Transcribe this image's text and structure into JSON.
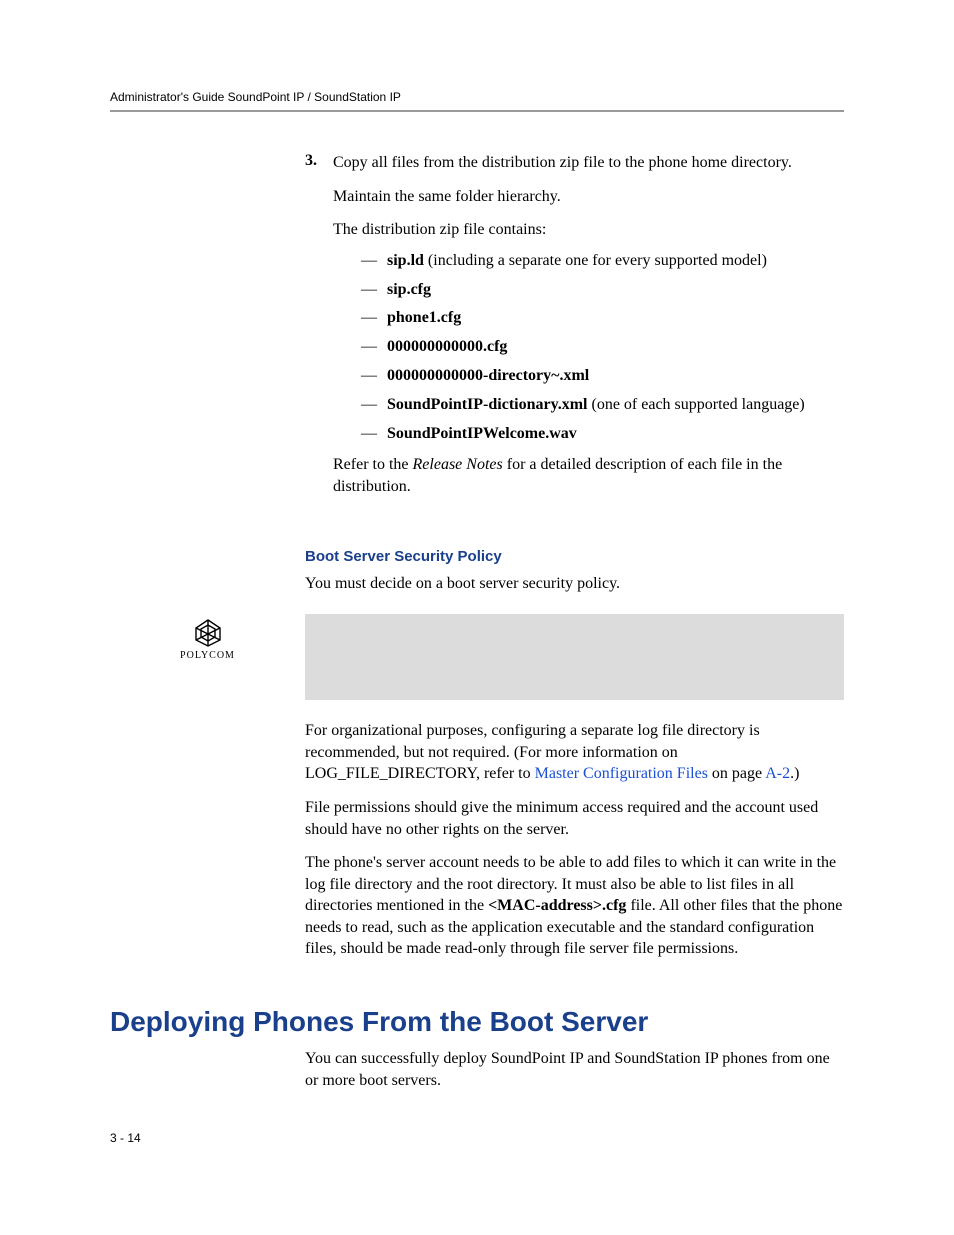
{
  "header": {
    "running": "Administrator's Guide SoundPoint IP / SoundStation IP"
  },
  "step": {
    "num": "3.",
    "p1": "Copy all files from the distribution zip file to the phone home directory.",
    "p2": "Maintain the same folder hierarchy.",
    "p3": "The distribution zip file contains:"
  },
  "files": {
    "f1b": "sip.ld",
    "f1r": " (including a separate one for every supported model)",
    "f2": "sip.cfg",
    "f3": "phone1.cfg",
    "f4": "000000000000.cfg",
    "f5": "000000000000-directory~.xml",
    "f6b": "SoundPointIP-dictionary.xml",
    "f6r": " (one of each supported language)",
    "f7": "SoundPointIPWelcome.wav"
  },
  "refer": {
    "pre": "Refer to the ",
    "em": "Release Notes",
    "post": " for a detailed description of each file in the distribution."
  },
  "sub1": {
    "title": "Boot Server Security Policy",
    "p1": "You must decide on a boot server security policy."
  },
  "logo": {
    "name": "POLYCOM"
  },
  "org": {
    "p1a": "For organizational purposes, configuring a separate log file directory is recommended, but not required. (For more information on LOG_FILE_DIRECTORY, refer to ",
    "link": "Master Configuration Files",
    "p1b": " on page ",
    "pageref": "A-2",
    "p1c": ".)",
    "p2": "File permissions should give the minimum access required and the account used should have no other rights on the server.",
    "p3a": "The phone's server account needs to be able to add files to which it can write in the log file directory and the root directory. It must also be able to list files in all directories mentioned in the ",
    "p3b": "<MAC-address>.cfg",
    "p3c": " file. All other files that the phone needs to read, such as the application executable and the standard configuration files, should be made read-only through file server file permissions."
  },
  "section": {
    "title": "Deploying Phones From the Boot Server",
    "p1": "You can successfully deploy SoundPoint IP and SoundStation IP phones from one or more boot servers."
  },
  "footer": {
    "pagenum": "3 - 14"
  }
}
